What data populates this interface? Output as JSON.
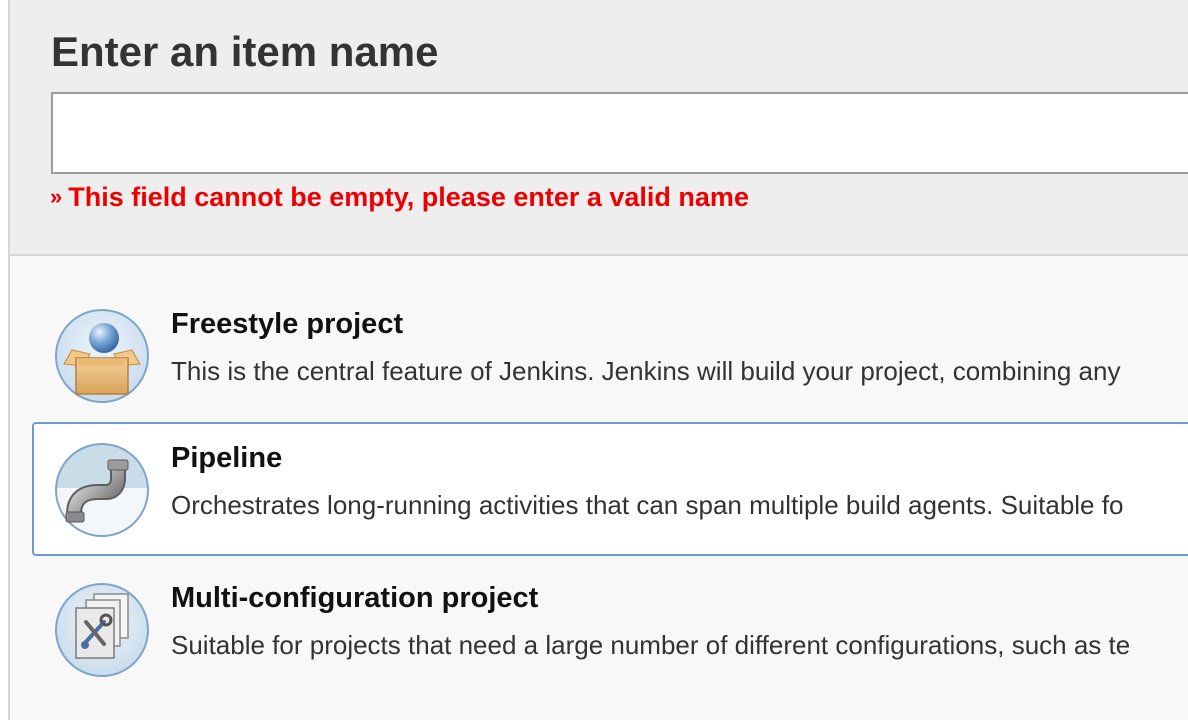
{
  "form": {
    "title": "Enter an item name",
    "item_name_value": "",
    "error_prefix": "»",
    "error_message": "This field cannot be empty, please enter a valid name"
  },
  "item_types": [
    {
      "name": "Freestyle project",
      "description": "This is the central feature of Jenkins. Jenkins will build your project, combining any",
      "icon": "freestyle-box-icon",
      "selected": false
    },
    {
      "name": "Pipeline",
      "description": "Orchestrates long-running activities that can span multiple build agents. Suitable fo",
      "icon": "pipeline-pipe-icon",
      "selected": true
    },
    {
      "name": "Multi-configuration project",
      "description": "Suitable for projects that need a large number of different configurations, such as te",
      "icon": "multi-config-pages-icon",
      "selected": false
    }
  ],
  "colors": {
    "error": "#ee0000",
    "selected_border": "#6b9bd2"
  }
}
